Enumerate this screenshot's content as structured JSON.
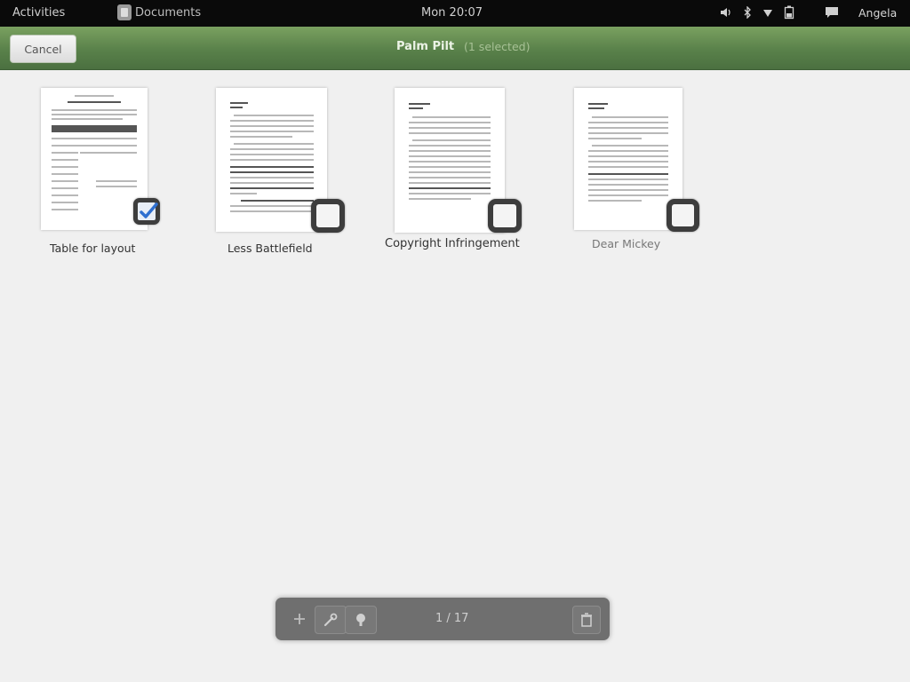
{
  "top_panel": {
    "activities": "Activities",
    "app_menu": "Documents",
    "clock": "Mon 20:07",
    "user": "Angela",
    "tray_icons": [
      "volume-icon",
      "bluetooth-icon",
      "network-icon",
      "battery-icon",
      "chat-icon"
    ]
  },
  "header": {
    "cancel_label": "Cancel",
    "title": "Palm Pilt",
    "subtitle": "(1 selected)",
    "accent_color": "#5b834b"
  },
  "documents": [
    {
      "title": "Table for layout",
      "checked": true
    },
    {
      "title": "Less Battlefield",
      "checked": false
    },
    {
      "title": "Copyright Infringement",
      "checked": false
    },
    {
      "title": "Dear Mickey",
      "checked": false
    }
  ],
  "toolbar": {
    "count_text": "1 / 17",
    "icons": [
      "favorite-icon",
      "properties-icon",
      "share-icon",
      "trash-icon"
    ]
  }
}
